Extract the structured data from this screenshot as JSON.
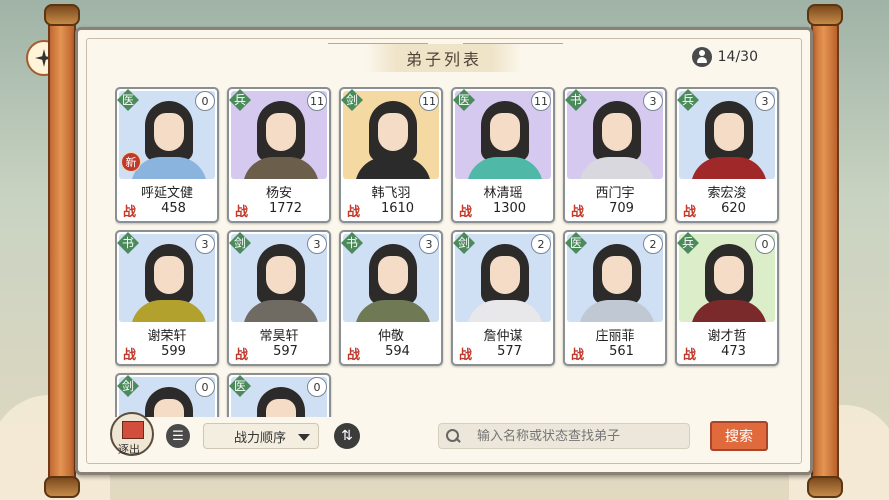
{
  "header": {
    "title": "弟子列表",
    "count": "14/30"
  },
  "disciples": [
    {
      "type": "医",
      "level": "0",
      "name": "呼延文健",
      "zhan": "战",
      "power": "458",
      "new": "新",
      "bg": "#cfdff4",
      "robe": "#8ab4dd"
    },
    {
      "type": "兵",
      "level": "11",
      "name": "杨安",
      "zhan": "战",
      "power": "1772",
      "bg": "#d6c9ef",
      "robe": "#6b5f4c"
    },
    {
      "type": "剑",
      "level": "11",
      "name": "韩飞羽",
      "zhan": "战",
      "power": "1610",
      "bg": "#f4d9a3",
      "robe": "#2b2b2b"
    },
    {
      "type": "医",
      "level": "11",
      "name": "林清瑶",
      "zhan": "战",
      "power": "1300",
      "bg": "#d6c9ef",
      "robe": "#4fb8a6"
    },
    {
      "type": "书",
      "level": "3",
      "name": "西门宇",
      "zhan": "战",
      "power": "709",
      "bg": "#d6c9ef",
      "robe": "#d8d8de"
    },
    {
      "type": "兵",
      "level": "3",
      "name": "索宏浚",
      "zhan": "战",
      "power": "620",
      "bg": "#cfdff4",
      "robe": "#a02828"
    },
    {
      "type": "书",
      "level": "3",
      "name": "谢荣轩",
      "zhan": "战",
      "power": "599",
      "bg": "#cfdff4",
      "robe": "#b3a12e"
    },
    {
      "type": "剑",
      "level": "3",
      "name": "常昊轩",
      "zhan": "战",
      "power": "597",
      "bg": "#cfdff4",
      "robe": "#6f6a62"
    },
    {
      "type": "书",
      "level": "3",
      "name": "仲敬",
      "zhan": "战",
      "power": "594",
      "bg": "#cfdff4",
      "robe": "#6f7a55"
    },
    {
      "type": "剑",
      "level": "2",
      "name": "詹仲谋",
      "zhan": "战",
      "power": "577",
      "bg": "#cfdff4",
      "robe": "#e8e8ea"
    },
    {
      "type": "医",
      "level": "2",
      "name": "庄丽菲",
      "zhan": "战",
      "power": "561",
      "bg": "#cfdff4",
      "robe": "#c0c8d4"
    },
    {
      "type": "兵",
      "level": "0",
      "name": "谢才哲",
      "zhan": "战",
      "power": "473",
      "bg": "#dbeec9",
      "robe": "#7a2a2a"
    },
    {
      "type": "剑",
      "level": "0",
      "name": "",
      "zhan": "",
      "power": "",
      "bg": "#cfdff4",
      "robe": "#555"
    },
    {
      "type": "医",
      "level": "0",
      "name": "",
      "zhan": "",
      "power": "",
      "bg": "#cfdff4",
      "robe": "#555"
    }
  ],
  "toolbar": {
    "exit_label": "逐出",
    "exit_tag": "品",
    "list_icon": "☰",
    "sort_label": "战力顺序",
    "swap_icon": "⇅",
    "search_placeholder": "输入名称或状态查找弟子",
    "search_button": "搜索"
  }
}
